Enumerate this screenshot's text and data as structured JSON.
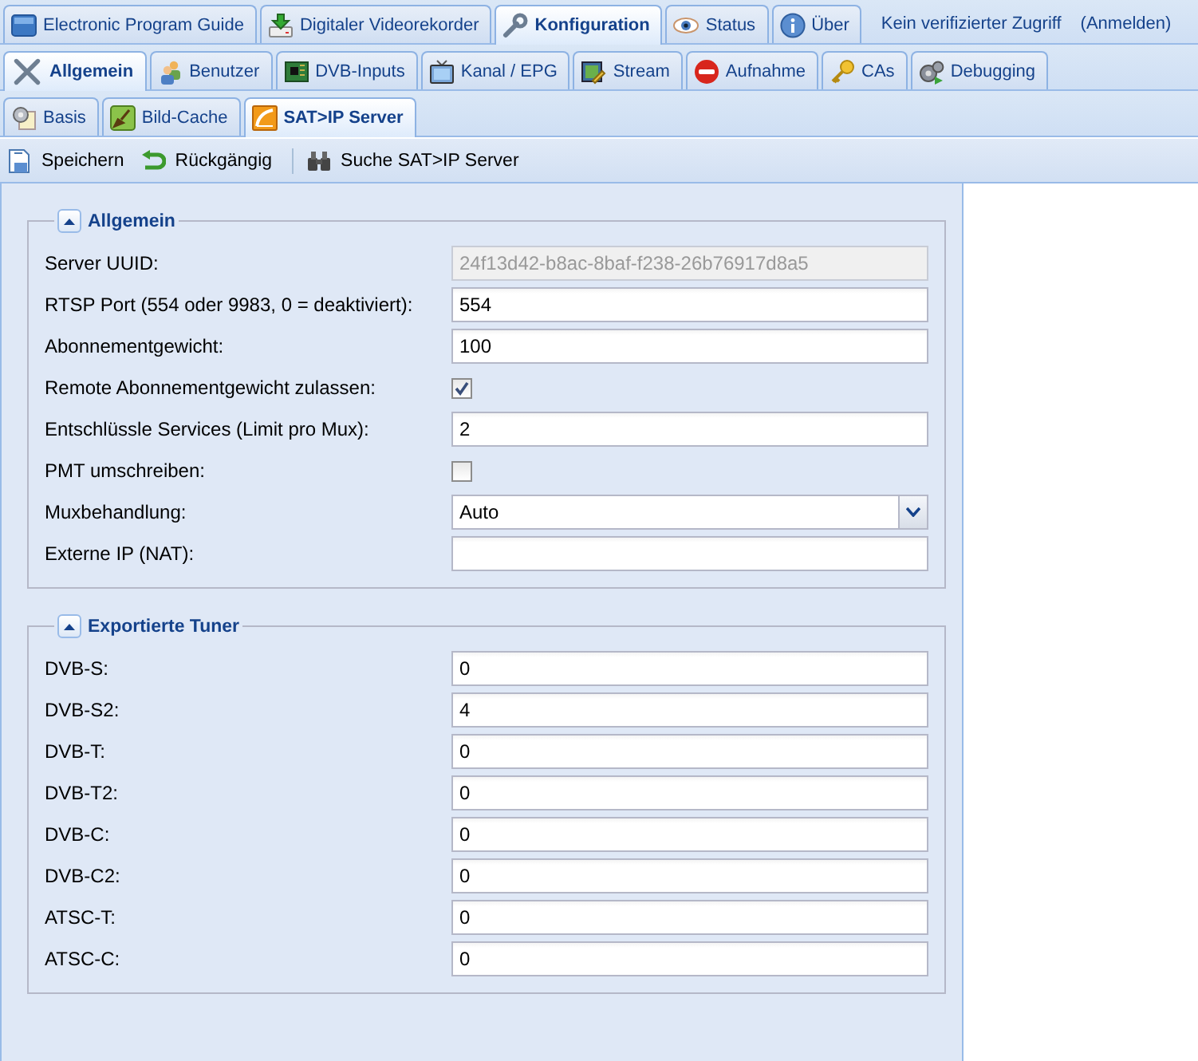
{
  "main_tabs": [
    {
      "label": "Electronic Program Guide",
      "selected": false
    },
    {
      "label": "Digitaler Videorekorder",
      "selected": false
    },
    {
      "label": "Konfiguration",
      "selected": true
    },
    {
      "label": "Status",
      "selected": false
    },
    {
      "label": "Über",
      "selected": false
    }
  ],
  "access_note": "Kein verifizierter Zugriff",
  "login_link": "(Anmelden)",
  "sub_tabs": [
    {
      "label": "Allgemein",
      "selected": true
    },
    {
      "label": "Benutzer",
      "selected": false
    },
    {
      "label": "DVB-Inputs",
      "selected": false
    },
    {
      "label": "Kanal / EPG",
      "selected": false
    },
    {
      "label": "Stream",
      "selected": false
    },
    {
      "label": "Aufnahme",
      "selected": false
    },
    {
      "label": "CAs",
      "selected": false
    },
    {
      "label": "Debugging",
      "selected": false
    }
  ],
  "section_tabs": [
    {
      "label": "Basis",
      "selected": false
    },
    {
      "label": "Bild-Cache",
      "selected": false
    },
    {
      "label": "SAT>IP Server",
      "selected": true
    }
  ],
  "toolbar": [
    {
      "label": "Speichern",
      "kind": "button"
    },
    {
      "label": "Rückgängig",
      "kind": "button"
    },
    {
      "kind": "separator"
    },
    {
      "label": "Suche SAT>IP Server",
      "kind": "button"
    }
  ],
  "sections": [
    {
      "title": "Allgemein",
      "expanded": true,
      "fields": [
        {
          "label": "Server UUID:",
          "kind": "text",
          "value": "24f13d42-b8ac-8baf-f238-26b76917d8a5",
          "disabled": true
        },
        {
          "label": "RTSP Port (554 oder 9983, 0 = deaktiviert):",
          "kind": "text",
          "value": "554",
          "disabled": false
        },
        {
          "label": "Abonnementgewicht:",
          "kind": "text",
          "value": "100",
          "disabled": false
        },
        {
          "label": "Remote Abonnementgewicht zulassen:",
          "kind": "checkbox",
          "checked": true
        },
        {
          "label": "Entschlüssle Services (Limit pro Mux):",
          "kind": "text",
          "value": "2",
          "disabled": false
        },
        {
          "label": "PMT umschreiben:",
          "kind": "checkbox",
          "checked": false
        },
        {
          "label": "Muxbehandlung:",
          "kind": "select",
          "value": "Auto"
        },
        {
          "label": "Externe IP (NAT):",
          "kind": "text",
          "disabled": false
        }
      ]
    },
    {
      "title": "Exportierte Tuner",
      "expanded": true,
      "fields": [
        {
          "label": "DVB-S:",
          "kind": "text",
          "value": "0",
          "disabled": false
        },
        {
          "label": "DVB-S2:",
          "kind": "text",
          "value": "4",
          "disabled": false
        },
        {
          "label": "DVB-T:",
          "kind": "text",
          "value": "0",
          "disabled": false
        },
        {
          "label": "DVB-T2:",
          "kind": "text",
          "value": "0",
          "disabled": false
        },
        {
          "label": "DVB-C:",
          "kind": "text",
          "value": "0",
          "disabled": false
        },
        {
          "label": "DVB-C2:",
          "kind": "text",
          "value": "0",
          "disabled": false
        },
        {
          "label": "ATSC-T:",
          "kind": "text",
          "value": "0",
          "disabled": false
        },
        {
          "label": "ATSC-C:",
          "kind": "text",
          "value": "0",
          "disabled": false
        }
      ]
    }
  ]
}
